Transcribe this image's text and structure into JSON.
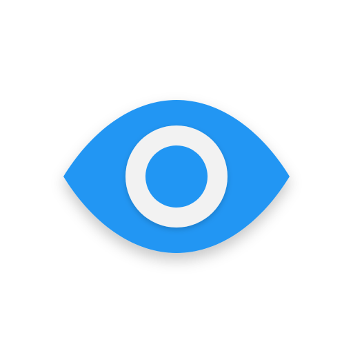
{
  "icon": {
    "name": "eye-icon",
    "colors": {
      "background": "#ffffff",
      "eye": "#2196F3",
      "ring": "#F2F2F2",
      "shadow": "#000000"
    }
  }
}
